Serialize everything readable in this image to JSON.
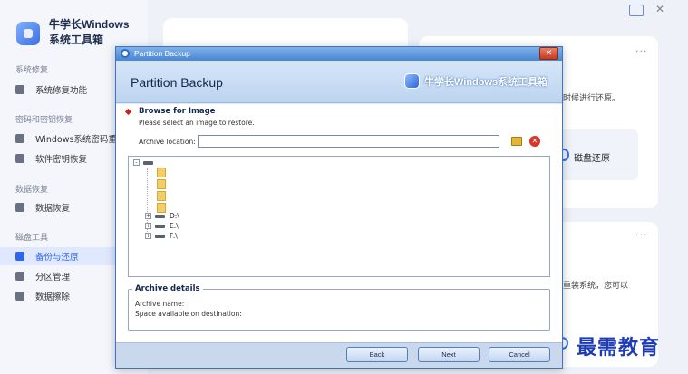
{
  "app": {
    "title": "牛学长Windows系统工具箱",
    "sidebar": {
      "sections": [
        {
          "title": "系统修复",
          "items": [
            {
              "label": "系统修复功能",
              "icon": "wrench-icon"
            }
          ]
        },
        {
          "title": "密码和密钥恢复",
          "items": [
            {
              "label": "Windows系统密码重置",
              "icon": "lock-icon"
            },
            {
              "label": "软件密钥恢复",
              "icon": "key-document-icon"
            }
          ]
        },
        {
          "title": "数据恢复",
          "items": [
            {
              "label": "数据恢复",
              "icon": "data-recovery-icon"
            }
          ]
        },
        {
          "title": "磁盘工具",
          "items": [
            {
              "label": "备份与还原",
              "icon": "backup-icon",
              "active": true
            },
            {
              "label": "分区管理",
              "icon": "partition-icon"
            },
            {
              "label": "数据擦除",
              "icon": "erase-icon"
            }
          ]
        }
      ]
    },
    "main": {
      "card1_text": "时候进行还原。",
      "restore_label": "磁盘还原",
      "card2_text": "重装系统，您可以",
      "more_dots": "···"
    },
    "watermark": "最需教育"
  },
  "dialog": {
    "window_title": "Partition Backup",
    "close_symbol": "✕",
    "header_title": "Partition Backup",
    "brand": "牛学长Windows系统工具箱",
    "section_title": "Browse for Image",
    "section_subtitle": "Please select an image to restore.",
    "archive_location_label": "Archive location:",
    "archive_location_value": "",
    "tree": {
      "drives": [
        "D:\\",
        "E:\\",
        "F:\\"
      ],
      "expand_symbol": "+",
      "collapse_symbol": "-"
    },
    "details": {
      "title": "Archive details",
      "archive_name_label": "Archive name:",
      "space_label": "Space available on destination:"
    },
    "buttons": {
      "back": "Back",
      "next": "Next",
      "cancel": "Cancel"
    }
  },
  "colors": {
    "accent": "#2f66e6",
    "dialog_border": "#3a74c9",
    "dialog_header": "#bcd4ef",
    "watermark": "#1d3bb6"
  }
}
